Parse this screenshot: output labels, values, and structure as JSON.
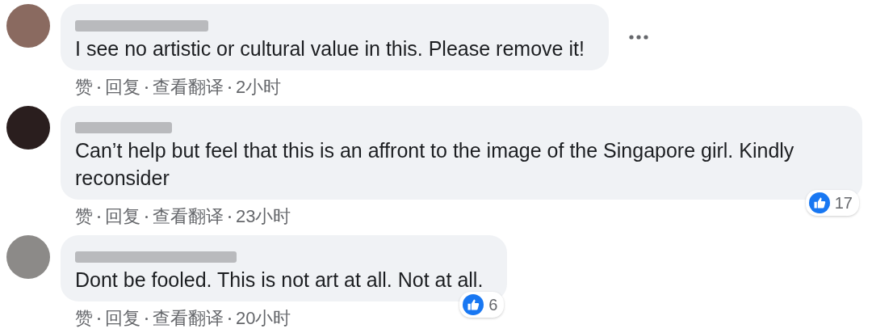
{
  "comments": [
    {
      "text": "I see no artistic or cultural value in this. Please remove it!",
      "actions": [
        "赞",
        "回复",
        "查看翻译"
      ],
      "time": "2小时",
      "menu_visible": true
    },
    {
      "text": "Can’t help but feel that this is an affront to the image of the Singapore girl. Kindly reconsider",
      "actions": [
        "赞",
        "回复",
        "查看翻译"
      ],
      "time": "23小时",
      "reactions": "17",
      "menu_visible": false
    },
    {
      "text": "Dont be fooled. This is not art at all. Not at all.",
      "actions": [
        "赞",
        "回复",
        "查看翻译"
      ],
      "time": "20小时",
      "reactions": "6",
      "menu_visible": false
    }
  ]
}
